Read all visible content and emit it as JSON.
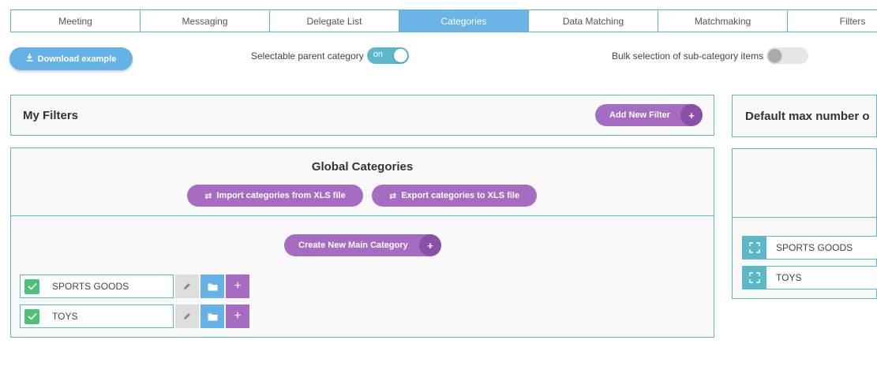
{
  "tabs": [
    "Meeting",
    "Messaging",
    "Delegate List",
    "Categories",
    "Data Matching",
    "Matchmaking",
    "Filters"
  ],
  "active_tab": "Categories",
  "toolbar": {
    "download_label": "Download example",
    "selectable_parent_label": "Selectable parent category",
    "selectable_parent_state": "on",
    "bulk_selection_label": "Bulk selection of sub-category items"
  },
  "filters_panel": {
    "title": "My Filters",
    "add_filter_label": "Add New Filter"
  },
  "global_categories": {
    "title": "Global Categories",
    "import_label": "Import categories from XLS file",
    "export_label": "Export categories to XLS file",
    "create_main_label": "Create New Main Category",
    "items": [
      {
        "name": "SPORTS GOODS",
        "checked": true
      },
      {
        "name": "TOYS",
        "checked": true
      }
    ]
  },
  "right_panel": {
    "title": "Default max number o",
    "items": [
      {
        "name": "SPORTS GOODS"
      },
      {
        "name": "TOYS"
      }
    ]
  },
  "colors": {
    "accent": "#5cb8c9",
    "active_tab": "#6ab4e6",
    "purple": "#a56cc1",
    "green_check": "#4ec07a"
  }
}
